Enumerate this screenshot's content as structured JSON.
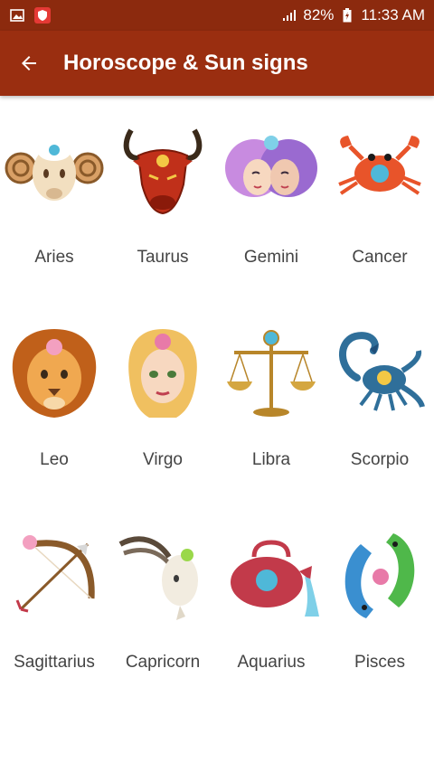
{
  "status_bar": {
    "battery": "82%",
    "time": "11:33 AM"
  },
  "app_bar": {
    "title": "Horoscope & Sun signs"
  },
  "signs": [
    {
      "label": "Aries",
      "icon": "aries-ram-icon",
      "color": "#e8c9a0"
    },
    {
      "label": "Taurus",
      "icon": "taurus-bull-icon",
      "color": "#c0301a"
    },
    {
      "label": "Gemini",
      "icon": "gemini-twins-icon",
      "color": "#a87ad0"
    },
    {
      "label": "Cancer",
      "icon": "cancer-crab-icon",
      "color": "#e8542a"
    },
    {
      "label": "Leo",
      "icon": "leo-lion-icon",
      "color": "#d9772a"
    },
    {
      "label": "Virgo",
      "icon": "virgo-maiden-icon",
      "color": "#f0c060"
    },
    {
      "label": "Libra",
      "icon": "libra-scales-icon",
      "color": "#d4a640"
    },
    {
      "label": "Scorpio",
      "icon": "scorpio-scorpion-icon",
      "color": "#2f6f9a"
    },
    {
      "label": "Sagittarius",
      "icon": "sagittarius-bow-icon",
      "color": "#8a5a2a"
    },
    {
      "label": "Capricorn",
      "icon": "capricorn-goat-icon",
      "color": "#e8e0d0"
    },
    {
      "label": "Aquarius",
      "icon": "aquarius-water-bearer-icon",
      "color": "#c23a4a"
    },
    {
      "label": "Pisces",
      "icon": "pisces-fish-icon",
      "color": "#3a8fd0"
    }
  ]
}
